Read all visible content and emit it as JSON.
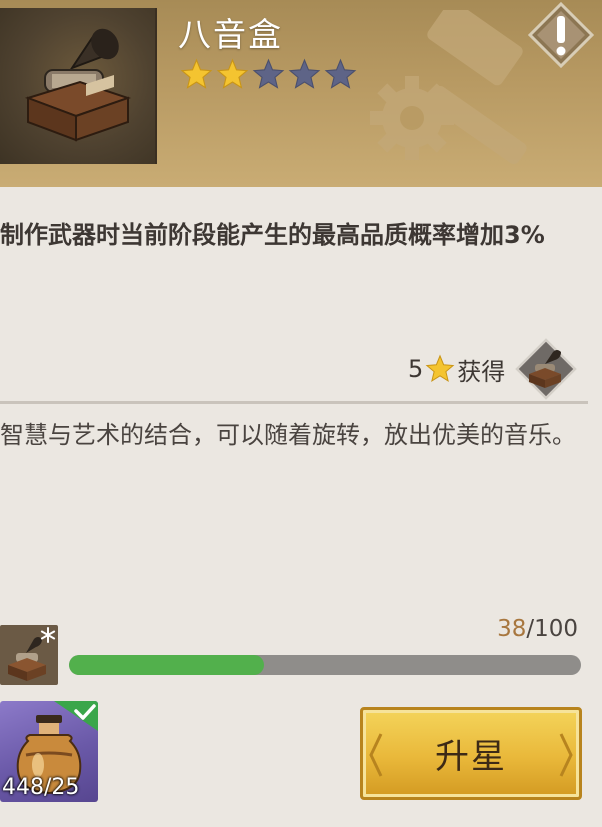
{
  "item": {
    "name": "八音盒",
    "stars_filled": 2,
    "stars_total": 5
  },
  "description": "制作武器时当前阶段能产生的最高品质概率增加3%",
  "obtain": {
    "star_count": "5",
    "label": "获得"
  },
  "lore": "智慧与艺术的结合，可以随着旋转，放出优美的音乐。",
  "progress": {
    "current": "38",
    "separator": "/",
    "max": "100",
    "fraction": 0.38
  },
  "material": {
    "count": "448/25"
  },
  "upgrade_button": {
    "label": "升星"
  },
  "colors": {
    "header_bg": "#b89a63",
    "star_gold": "#f4c430",
    "star_empty": "#5e6487",
    "progress_green": "#52b04c",
    "button_gold": "#e9b83a"
  },
  "icons": [
    "music-box-icon",
    "star-icon",
    "alert-icon",
    "gear-icon",
    "hammer-icon",
    "snowflake-icon",
    "check-icon",
    "potion-icon"
  ]
}
